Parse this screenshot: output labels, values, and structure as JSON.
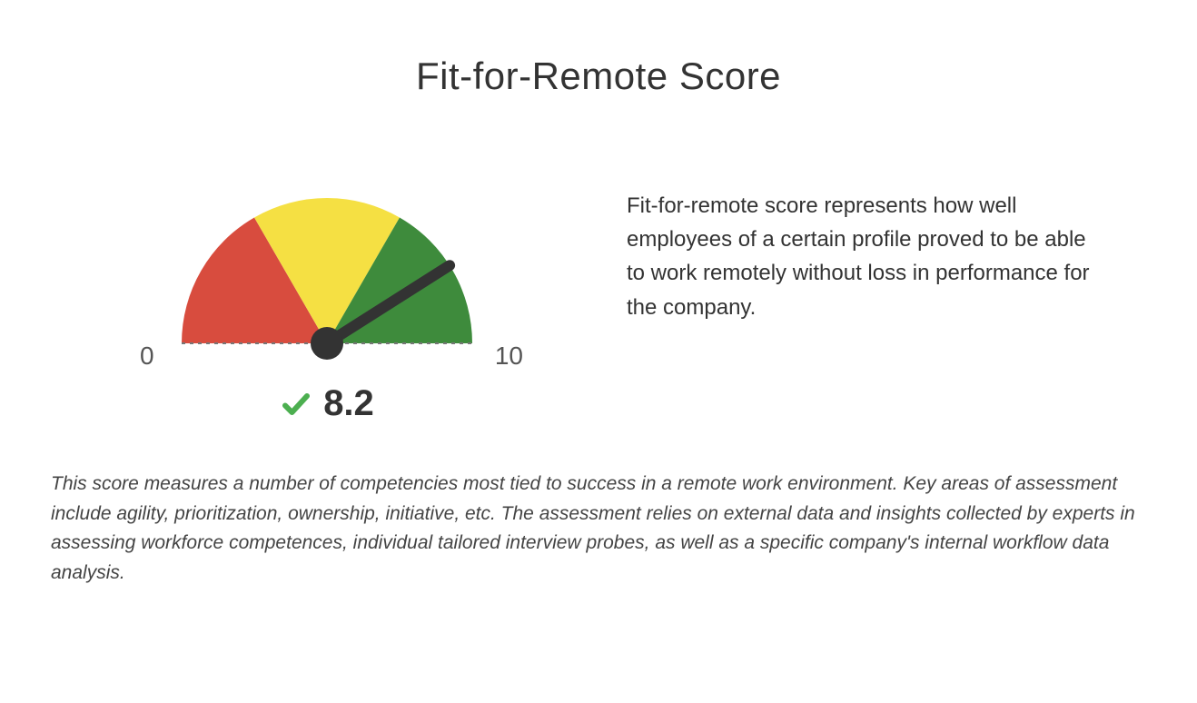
{
  "title": "Fit-for-Remote Score",
  "chart_data": {
    "type": "gauge",
    "min": 0,
    "max": 10,
    "value": 8.2,
    "zones": [
      {
        "from": 0,
        "to": 3.33,
        "color": "#D84C3E"
      },
      {
        "from": 3.33,
        "to": 6.67,
        "color": "#F5E043"
      },
      {
        "from": 6.67,
        "to": 10,
        "color": "#3E8B3C"
      }
    ],
    "scale_min_label": "0",
    "scale_max_label": "10"
  },
  "score_display": "8.2",
  "description": "Fit-for-remote score represents how well employees of a certain profile proved to be able to work remotely without loss in performance for the company.",
  "footnote": "This score measures a number of competencies most tied to success in a remote work environment. Key areas of assessment include agility, prioritization, ownership, initiative, etc. The assessment relies on external data and insights collected by experts in assessing workforce competences, individual tailored interview probes, as well as a specific company's internal workflow data analysis.",
  "colors": {
    "check": "#4CAF50",
    "needle": "#333333",
    "text": "#333333"
  }
}
